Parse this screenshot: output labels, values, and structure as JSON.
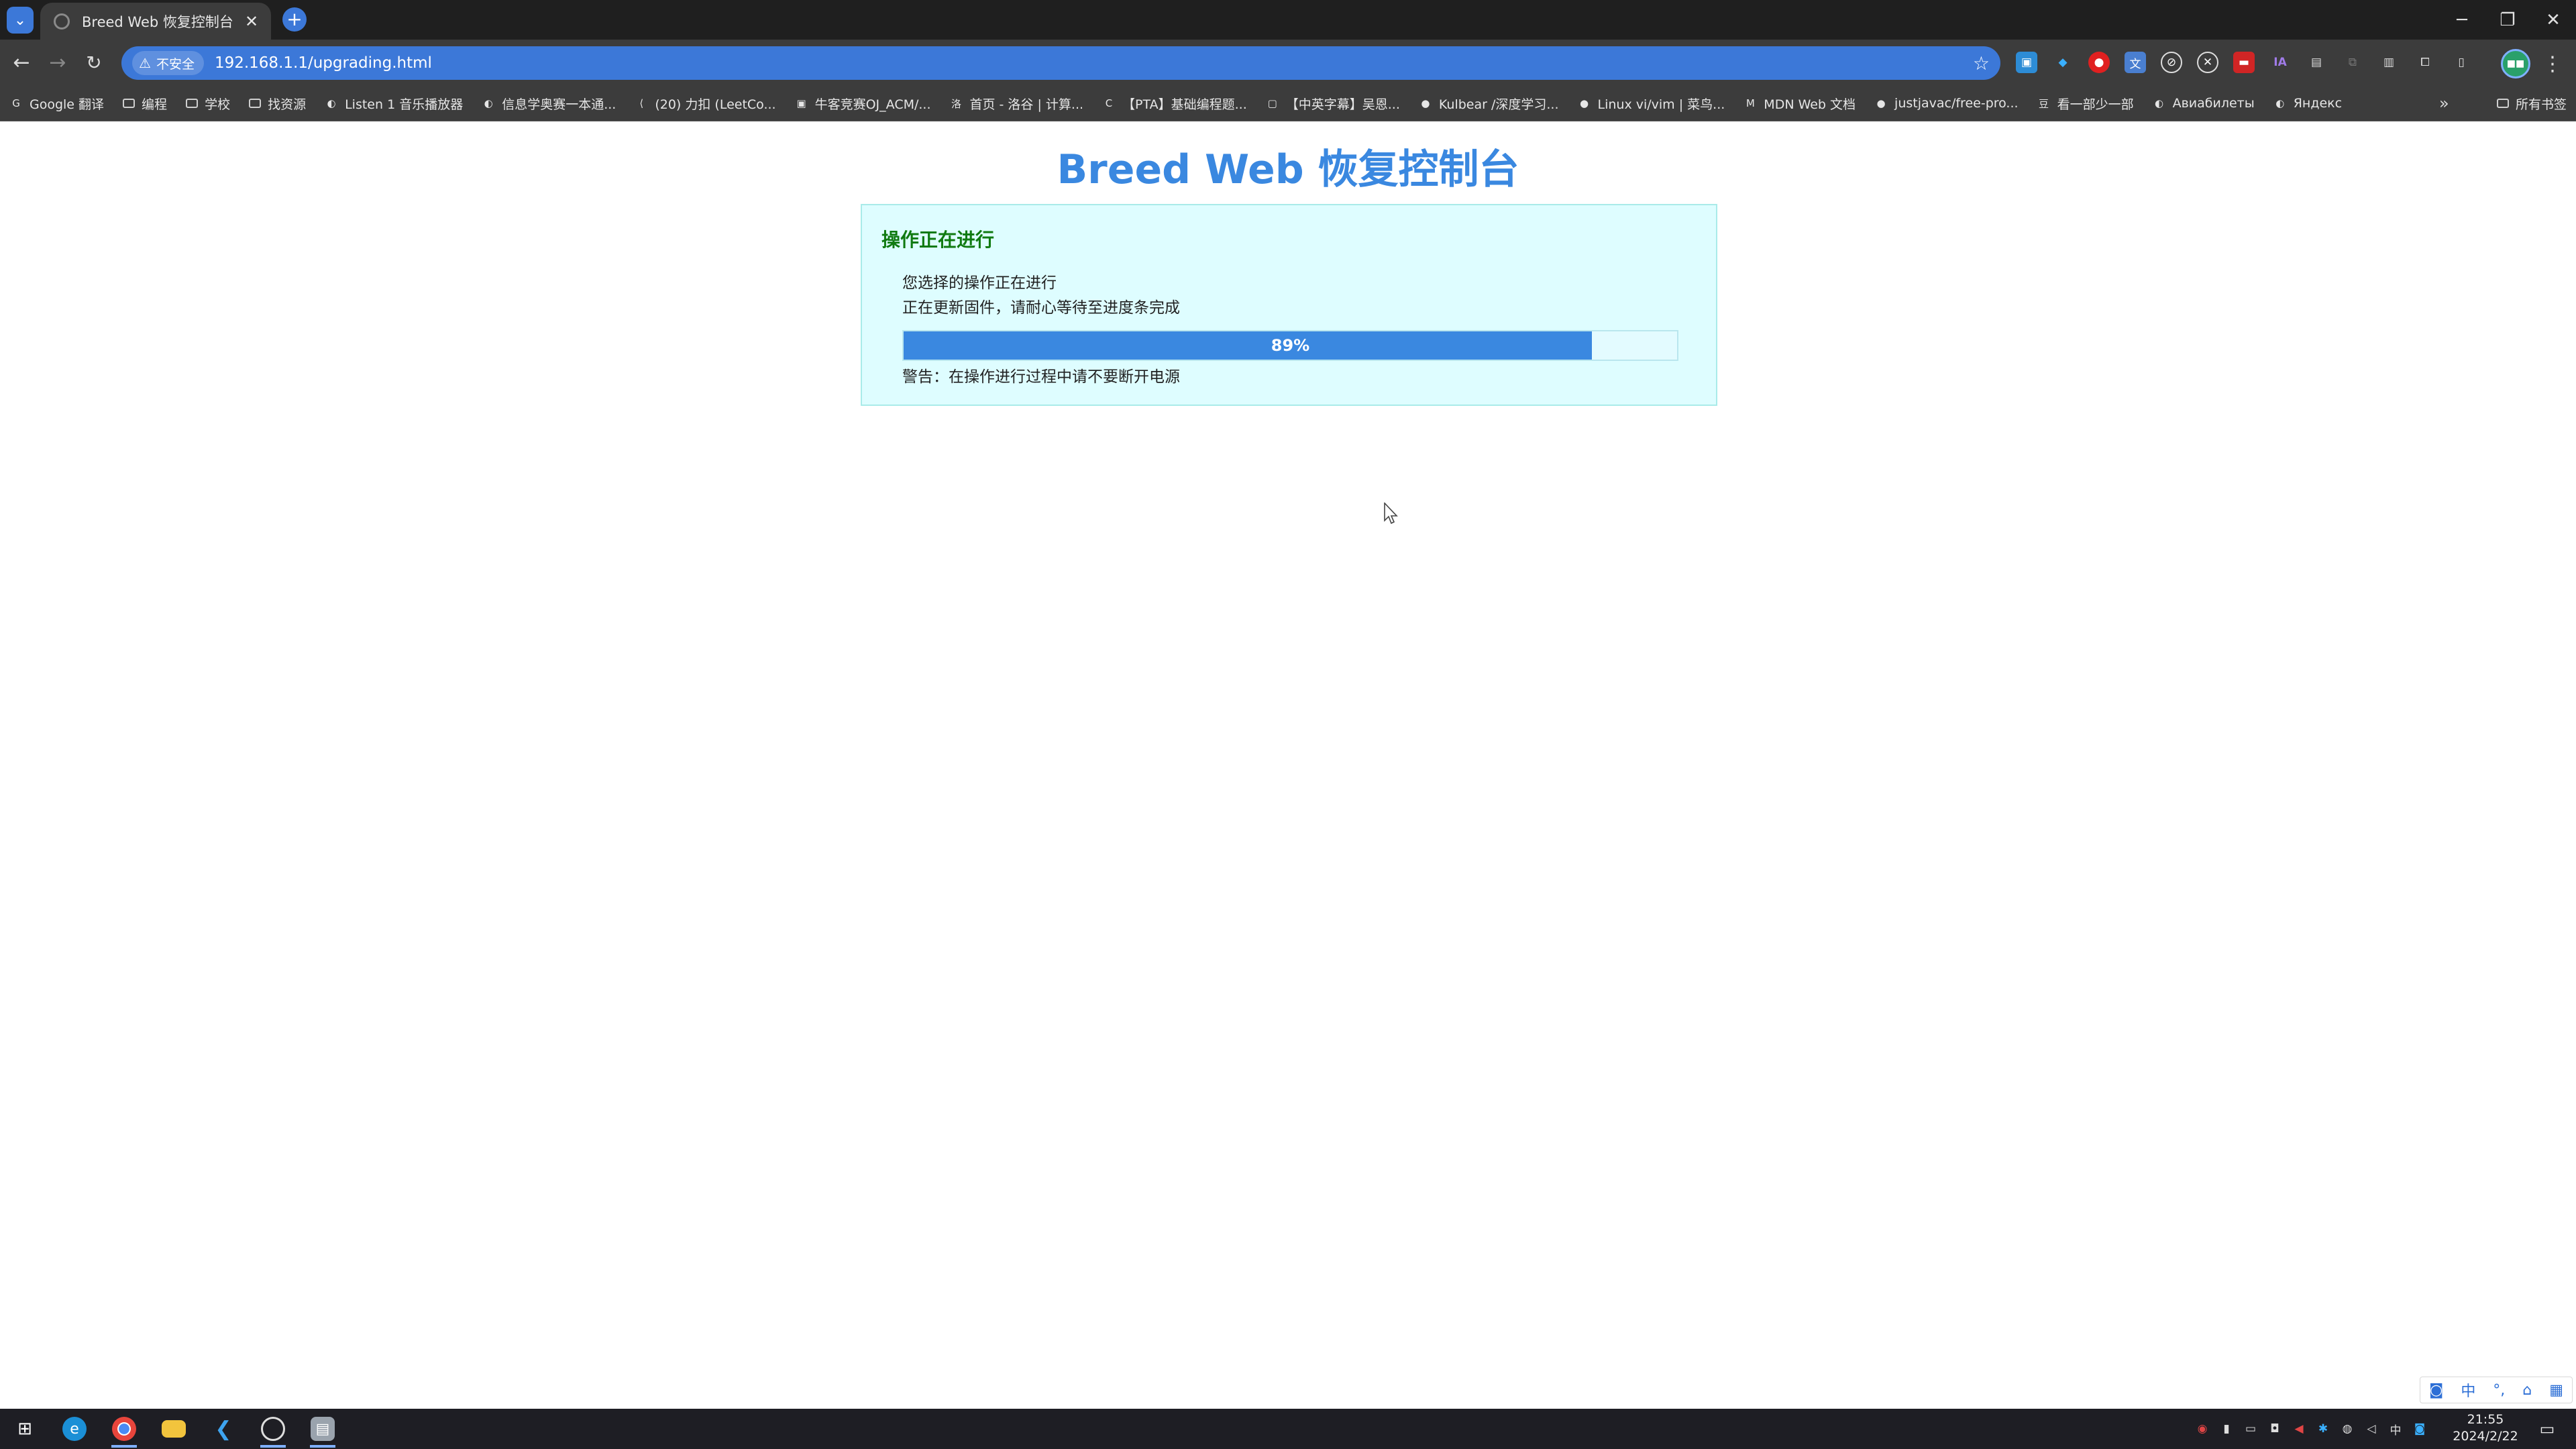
{
  "browser": {
    "tab": {
      "title": "Breed Web 恢复控制台"
    },
    "address": {
      "security_label": "不安全",
      "url": "192.168.1.1/upgrading.html"
    },
    "bookmarks": [
      {
        "label": "Google 翻译",
        "icon": "translate-icon"
      },
      {
        "label": "编程",
        "icon": "folder-icon"
      },
      {
        "label": "学校",
        "icon": "folder-icon"
      },
      {
        "label": "找资源",
        "icon": "folder-icon"
      },
      {
        "label": "Listen 1 音乐播放器",
        "icon": "globe-icon"
      },
      {
        "label": "信息学奥赛一本通...",
        "icon": "globe-icon"
      },
      {
        "label": "(20) 力扣 (LeetCo...",
        "icon": "leetcode-icon"
      },
      {
        "label": "牛客竞赛OJ_ACM/...",
        "icon": "nowcoder-icon"
      },
      {
        "label": "首页 - 洛谷 | 计算...",
        "icon": "luogu-icon"
      },
      {
        "label": "【PTA】基础编程题...",
        "icon": "pta-icon"
      },
      {
        "label": "【中英字幕】吴恩...",
        "icon": "bilibili-icon"
      },
      {
        "label": "Kulbear /深度学习...",
        "icon": "github-icon"
      },
      {
        "label": "Linux vi/vim | 菜鸟...",
        "icon": "runoob-icon"
      },
      {
        "label": "MDN Web 文档",
        "icon": "mdn-icon"
      },
      {
        "label": "justjavac/free-pro...",
        "icon": "github-icon"
      },
      {
        "label": "看一部少一部",
        "icon": "douban-icon"
      },
      {
        "label": "Авиабилеты",
        "icon": "globe-icon"
      },
      {
        "label": "Яндекс",
        "icon": "globe-icon"
      }
    ],
    "all_bookmarks_label": "所有书签",
    "profile_initials": "■■"
  },
  "page": {
    "title": "Breed Web 恢复控制台",
    "panel": {
      "heading": "操作正在进行",
      "line1": "您选择的操作正在进行",
      "line2": "正在更新固件，请耐心等待至进度条完成",
      "progress_percent": 89,
      "progress_label": "89%",
      "warning": "警告：在操作进行过程中请不要断开电源"
    }
  },
  "ime": {
    "mode_label": "中",
    "punct_label": "°,"
  },
  "taskbar": {
    "time": "21:55",
    "date": "2024/2/22",
    "tray_lang": "中"
  },
  "colors": {
    "title_blue": "#3a88e0",
    "heading_green": "#107a10",
    "panel_bg": "#defdff",
    "progress_fill": "#3a88e0"
  }
}
